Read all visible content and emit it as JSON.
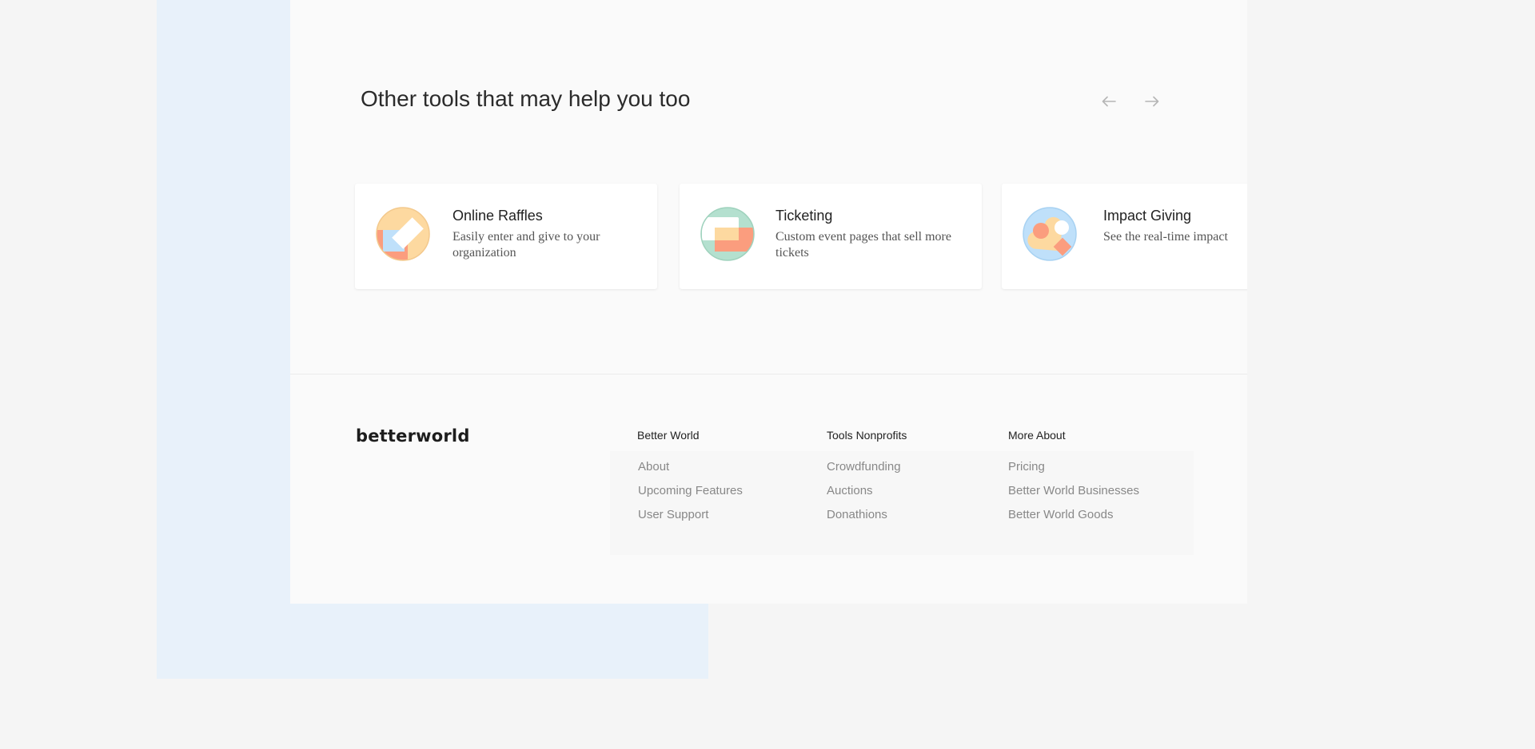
{
  "section": {
    "title": "Other tools that may help you too",
    "prev_icon": "arrow-left-icon",
    "next_icon": "arrow-right-icon"
  },
  "cards": [
    {
      "title": "Online Raffles",
      "description": "Easily enter and give to your organization",
      "icon": "raffle-ticket-icon"
    },
    {
      "title": "Ticketing",
      "description": "Custom event pages that sell more tickets",
      "icon": "ticket-icon"
    },
    {
      "title": "Impact Giving",
      "description": "See the real-time impact",
      "icon": "heart-icon"
    }
  ],
  "footer": {
    "logo": "betterworld",
    "columns": [
      {
        "title": "Better World",
        "links": [
          "About",
          "Upcoming Features",
          "User Support"
        ]
      },
      {
        "title": "Tools Nonprofits",
        "links": [
          "Crowdfunding",
          "Auctions",
          "Donathions"
        ]
      },
      {
        "title": "More About",
        "links": [
          "Pricing",
          "Better World Businesses",
          "Better World Goods"
        ]
      }
    ]
  },
  "colors": {
    "background": "#f5f5f5",
    "page": "#fafafa",
    "accent_blue": "#e8f1fa",
    "icon_orange": "#fdd9a0",
    "icon_coral": "#fb9d7e",
    "icon_green": "#b4e0cf",
    "icon_blue": "#bfe0fa"
  }
}
